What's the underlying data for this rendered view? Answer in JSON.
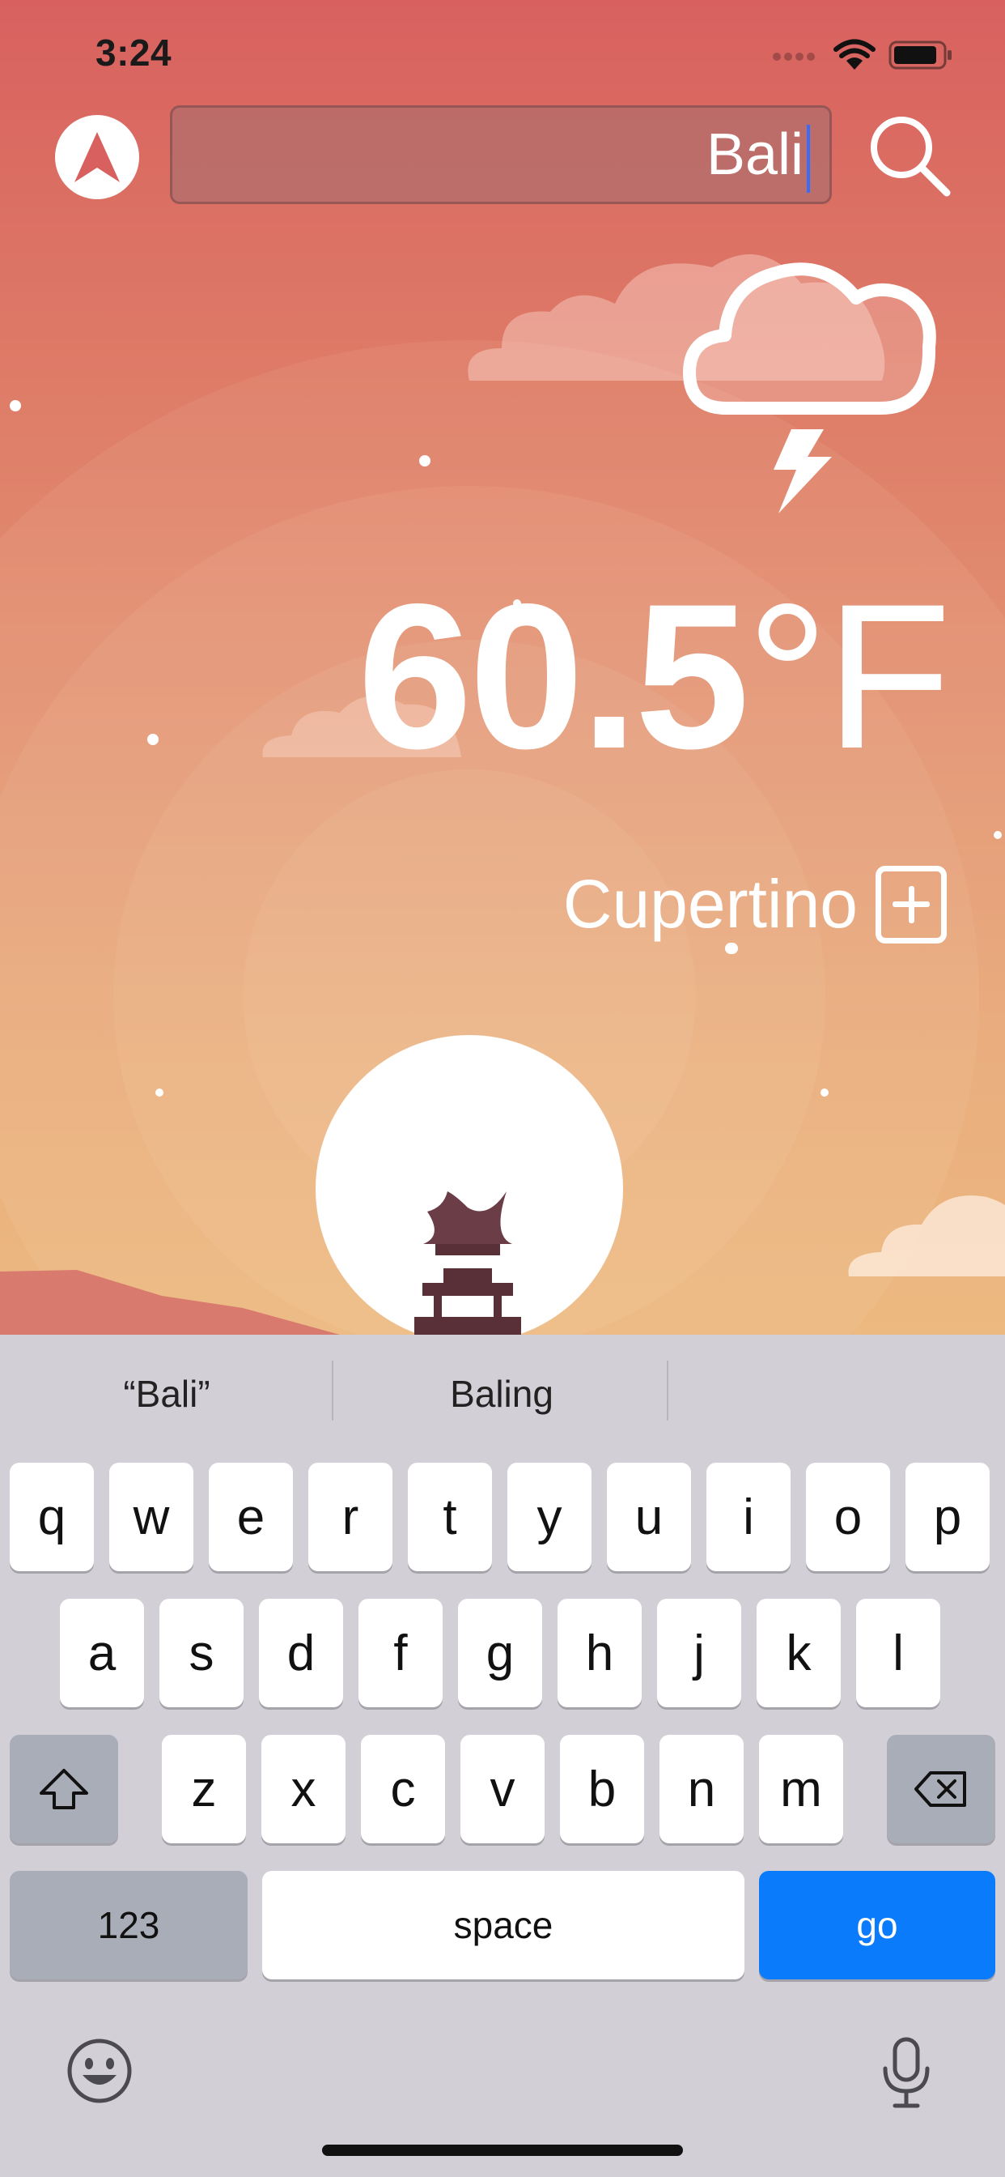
{
  "status_bar": {
    "time": "3:24"
  },
  "search": {
    "value": "Bali"
  },
  "weather": {
    "temperature": "60.5",
    "unit": "°F",
    "city": "Cupertino",
    "condition_icon": "cloud-lightning-icon"
  },
  "suggestions": [
    "“Bali”",
    "Baling",
    ""
  ],
  "keyboard": {
    "row1": [
      "q",
      "w",
      "e",
      "r",
      "t",
      "y",
      "u",
      "i",
      "o",
      "p"
    ],
    "row2": [
      "a",
      "s",
      "d",
      "f",
      "g",
      "h",
      "j",
      "k",
      "l"
    ],
    "row3": [
      "z",
      "x",
      "c",
      "v",
      "b",
      "n",
      "m"
    ],
    "numbers_label": "123",
    "space_label": "space",
    "go_label": "go"
  },
  "colors": {
    "go_key": "#0a7cfb",
    "sky_top": "#d8615f",
    "sky_bottom": "#ebb57a"
  }
}
